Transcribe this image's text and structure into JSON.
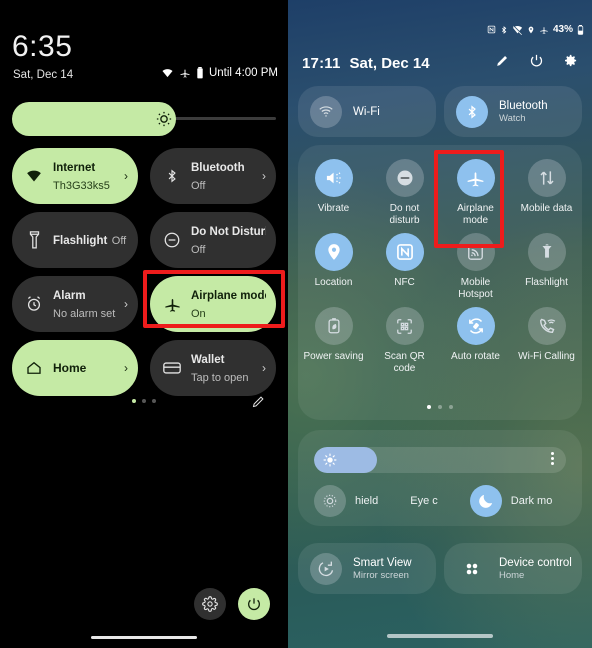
{
  "left_panel": {
    "clock": "6:35",
    "date": "Sat, Dec 14",
    "status": {
      "wifi_icon": "wifi-icon",
      "airplane_icon": "airplane-icon",
      "battery_icon": "battery-icon",
      "battery_text": "Until 4:00 PM"
    },
    "brightness": {
      "icon": "brightness-icon",
      "level_percent": 60
    },
    "tiles": [
      {
        "name": "internet",
        "icon": "wifi-icon",
        "title": "Internet",
        "subtitle": "Th3G33ks5",
        "state": "on",
        "chevron": "›"
      },
      {
        "name": "bluetooth",
        "icon": "bluetooth-icon",
        "title": "Bluetooth",
        "subtitle": "Off",
        "state": "off",
        "chevron": "›"
      },
      {
        "name": "flashlight",
        "icon": "flashlight-icon",
        "title": "Flashlight",
        "subtitle": "Off",
        "state": "off",
        "chevron": ""
      },
      {
        "name": "do-not-disturb",
        "icon": "do-not-disturb-icon",
        "title": "Do Not Disturb",
        "subtitle": "Off",
        "state": "off",
        "chevron": ""
      },
      {
        "name": "alarm",
        "icon": "alarm-icon",
        "title": "Alarm",
        "subtitle": "No alarm set",
        "state": "off",
        "chevron": "›"
      },
      {
        "name": "airplane-mode",
        "icon": "airplane-icon",
        "title": "Airplane mode",
        "subtitle": "On",
        "state": "on",
        "chevron": ""
      },
      {
        "name": "home",
        "icon": "home-icon",
        "title": "Home",
        "subtitle": "",
        "state": "on",
        "chevron": "›"
      },
      {
        "name": "wallet",
        "icon": "wallet-icon",
        "title": "Wallet",
        "subtitle": "Tap to open",
        "state": "off",
        "chevron": "›"
      }
    ],
    "page_dots": {
      "count": 3,
      "active_index": 0
    },
    "edit_icon": "pencil-icon",
    "bottom_buttons": [
      {
        "name": "settings",
        "icon": "gear-icon"
      },
      {
        "name": "power",
        "icon": "power-icon"
      }
    ]
  },
  "right_panel": {
    "status": {
      "nfc_icon": "nfc-icon",
      "bluetooth_icon": "bluetooth-icon",
      "wifi_off_icon": "wifi-off-icon",
      "location_icon": "location-icon",
      "airplane_icon": "airplane-icon",
      "battery_percent": "43%",
      "battery_icon": "battery-icon"
    },
    "header": {
      "time": "17:11",
      "date": "Sat, Dec 14",
      "icons": [
        {
          "name": "edit",
          "icon": "pencil-icon"
        },
        {
          "name": "power",
          "icon": "power-icon"
        },
        {
          "name": "settings",
          "icon": "gear-icon"
        }
      ]
    },
    "top_tiles": [
      {
        "name": "wifi",
        "icon": "wifi-icon",
        "title": "Wi-Fi",
        "subtitle": "",
        "state": "off"
      },
      {
        "name": "bluetooth",
        "icon": "bluetooth-icon",
        "title": "Bluetooth",
        "subtitle": "Watch",
        "state": "on"
      }
    ],
    "quick_settings": [
      {
        "name": "vibrate",
        "icon": "vibrate-icon",
        "label": "Vibrate",
        "state": "on"
      },
      {
        "name": "do-not-disturb",
        "icon": "do-not-disturb-icon",
        "label": "Do not disturb",
        "state": "off"
      },
      {
        "name": "airplane-mode",
        "icon": "airplane-icon",
        "label": "Airplane mode",
        "state": "on"
      },
      {
        "name": "mobile-data",
        "icon": "mobile-data-icon",
        "label": "Mobile data",
        "state": "off"
      },
      {
        "name": "location",
        "icon": "location-icon",
        "label": "Location",
        "state": "on"
      },
      {
        "name": "nfc",
        "icon": "nfc-icon",
        "label": "NFC",
        "state": "on"
      },
      {
        "name": "mobile-hotspot",
        "icon": "hotspot-icon",
        "label": "Mobile Hotspot",
        "state": "off"
      },
      {
        "name": "flashlight",
        "icon": "flashlight-icon",
        "label": "Flashlight",
        "state": "off"
      },
      {
        "name": "power-saving",
        "icon": "power-saving-icon",
        "label": "Power saving",
        "state": "off"
      },
      {
        "name": "scan-qr-code",
        "icon": "qr-code-icon",
        "label": "Scan QR code",
        "state": "off"
      },
      {
        "name": "auto-rotate",
        "icon": "auto-rotate-icon",
        "label": "Auto rotate",
        "state": "on"
      },
      {
        "name": "wifi-calling",
        "icon": "wifi-calling-icon",
        "label": "Wi-Fi Calling",
        "state": "off"
      }
    ],
    "page_dots": {
      "count": 3,
      "active_index": 0
    },
    "brightness": {
      "icon": "brightness-icon",
      "level_percent": 25,
      "menu_icon": "kebab-menu-icon"
    },
    "display_modes": [
      {
        "name": "eye-comfort-shield",
        "icon": "eye-comfort-icon",
        "label": "hield",
        "state": "off"
      },
      {
        "name": "eye-comfort-label",
        "icon": "",
        "label": "Eye c",
        "state": "off"
      },
      {
        "name": "dark-mode",
        "icon": "moon-icon",
        "label": "Dark mo",
        "state": "on"
      }
    ],
    "bottom_tiles": [
      {
        "name": "smart-view",
        "icon": "smart-view-icon",
        "title": "Smart View",
        "subtitle": "Mirror screen"
      },
      {
        "name": "device-control",
        "icon": "device-control-icon",
        "title": "Device control",
        "subtitle": "Home"
      }
    ]
  },
  "highlights": {
    "left_airplane_label": "Airplane mode highlight",
    "right_airplane_label": "Airplane mode highlight"
  },
  "colors": {
    "accent_green": "#c5eaa5",
    "accent_blue": "#8ec1ee",
    "highlight_red": "#ee1c1c",
    "tile_dark": "#303030"
  }
}
